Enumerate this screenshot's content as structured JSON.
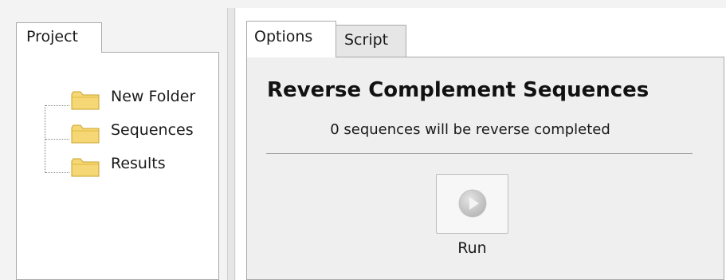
{
  "project_panel": {
    "tab_label": "Project",
    "tree_items": [
      {
        "label": "New Folder",
        "icon": "folder-icon"
      },
      {
        "label": "Sequences",
        "icon": "folder-icon"
      },
      {
        "label": "Results",
        "icon": "folder-icon"
      }
    ]
  },
  "main_panel": {
    "tabs": [
      {
        "label": "Options",
        "active": true
      },
      {
        "label": "Script",
        "active": false
      }
    ],
    "heading": "Reverse Complement Sequences",
    "subtitle": "0 sequences will be reverse completed",
    "run_button": {
      "label": "Run",
      "icon": "play-icon",
      "disabled": true
    }
  },
  "colors": {
    "folder_fill": "#f6d775",
    "folder_stroke": "#c9a227",
    "panel_background": "#efefef",
    "inactive_tab": "#e6e6e6"
  }
}
